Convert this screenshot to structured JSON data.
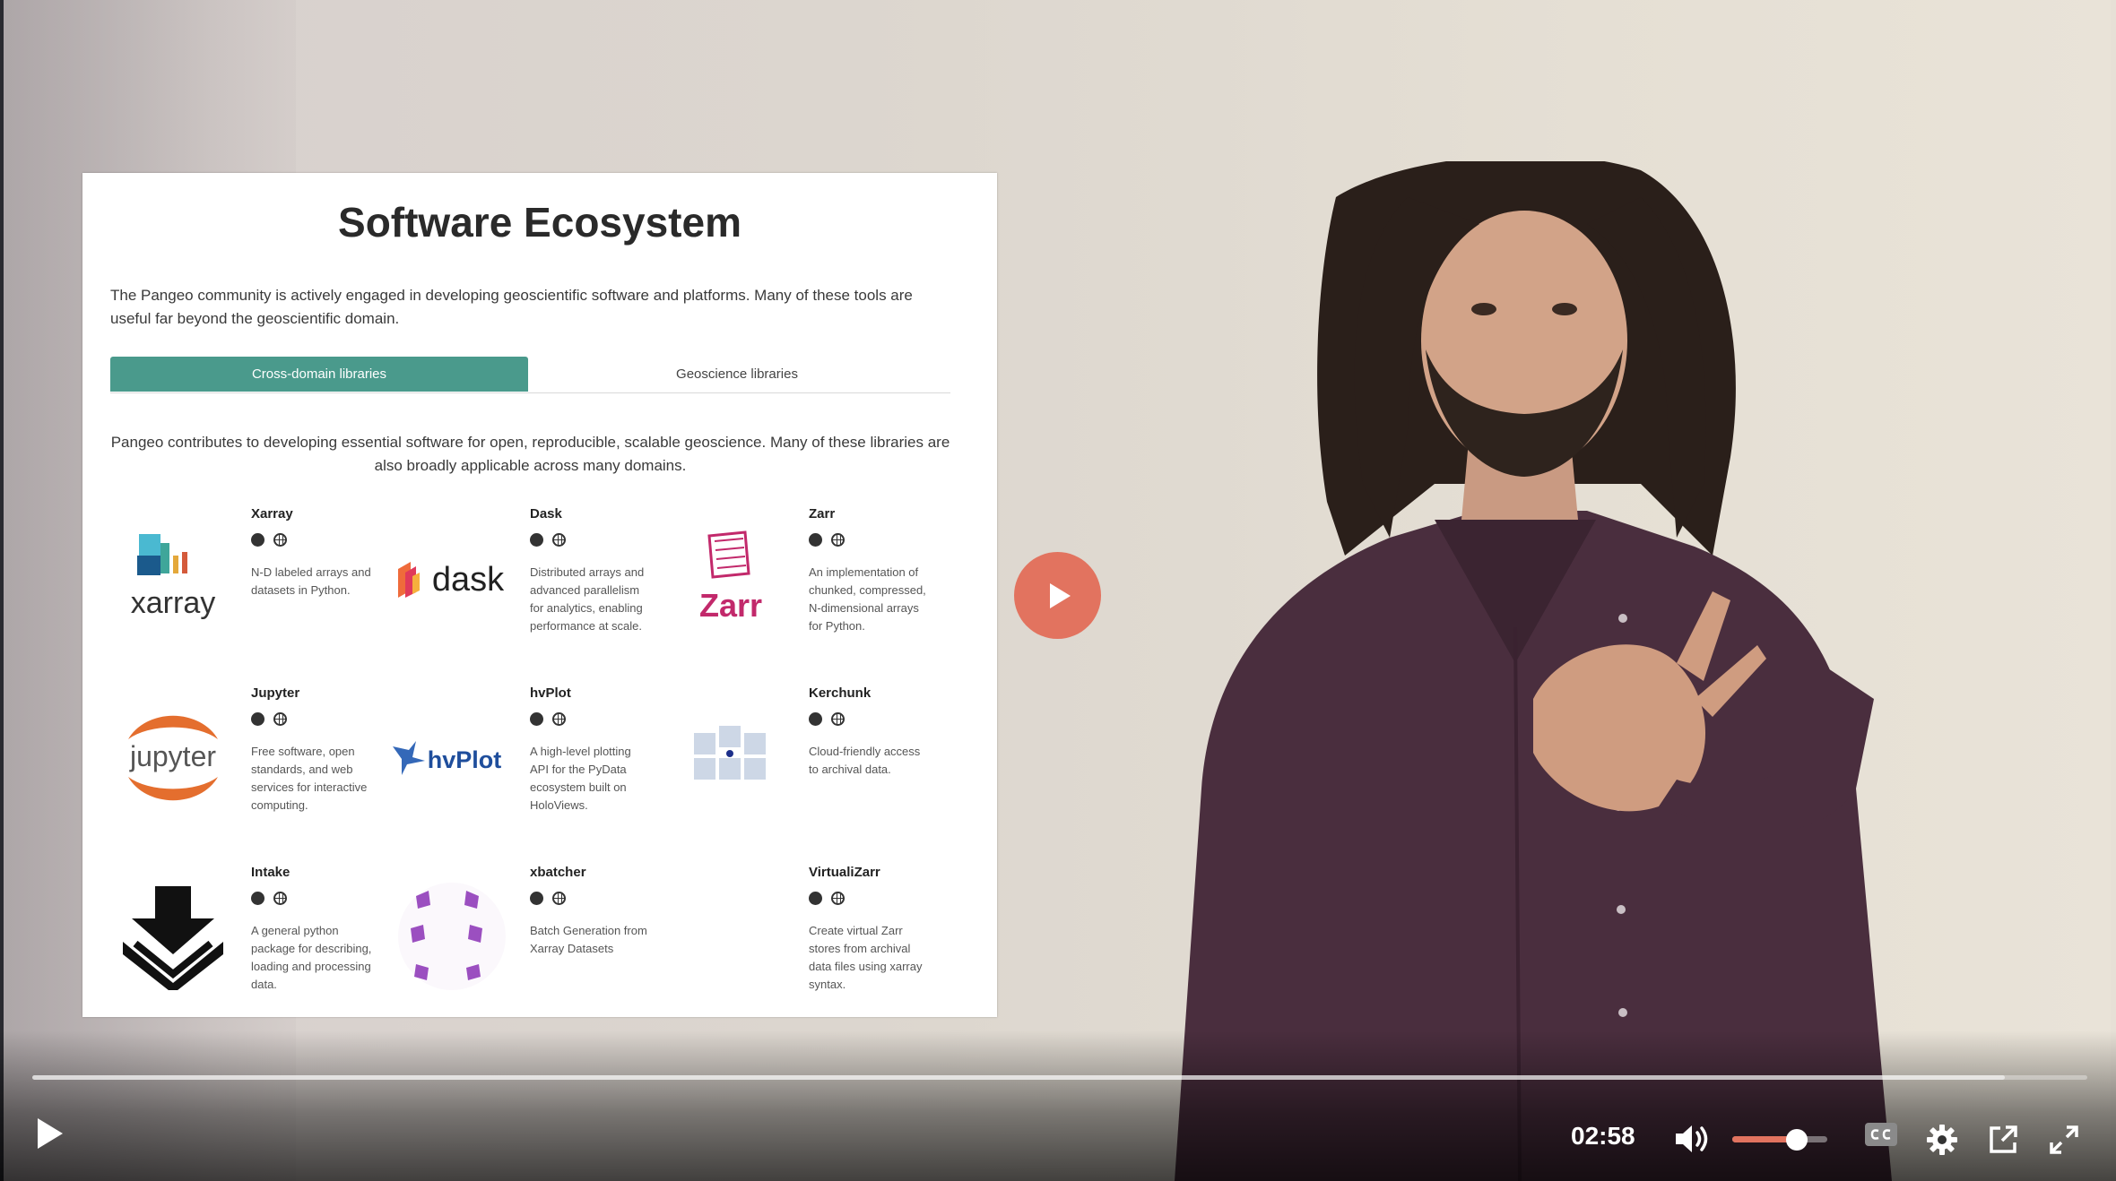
{
  "slide": {
    "title": "Software Ecosystem",
    "intro": "The Pangeo community is actively engaged in developing geoscientific software and platforms. Many of these tools are useful far beyond the geoscientific domain.",
    "tabs": [
      {
        "label": "Cross-domain libraries",
        "active": true
      },
      {
        "label": "Geoscience libraries",
        "active": false
      }
    ],
    "subintro": "Pangeo contributes to developing essential software for open, reproducible, scalable geoscience. Many of these libraries are also broadly applicable across many domains.",
    "libraries": [
      {
        "name": "Xarray",
        "logo_text": "xarray",
        "description": "N-D labeled arrays and datasets in Python."
      },
      {
        "name": "Dask",
        "logo_text": "dask",
        "description": "Distributed arrays and advanced parallelism for analytics, enabling performance at scale."
      },
      {
        "name": "Zarr",
        "logo_text": "Zarr",
        "description": "An implementation of chunked, compressed, N-dimensional arrays for Python."
      },
      {
        "name": "Jupyter",
        "logo_text": "jupyter",
        "description": "Free software, open standards, and web services for interactive computing."
      },
      {
        "name": "hvPlot",
        "logo_text": "hvPlot",
        "description": "A high-level plotting API for the PyData ecosystem built on HoloViews."
      },
      {
        "name": "Kerchunk",
        "logo_text": "",
        "description": "Cloud-friendly access to archival data."
      },
      {
        "name": "Intake",
        "logo_text": "",
        "description": "A general python package for describing, loading and processing data."
      },
      {
        "name": "xbatcher",
        "logo_text": "",
        "description": "Batch Generation from Xarray Datasets"
      },
      {
        "name": "VirtualiZarr",
        "logo_text": "",
        "description": "Create virtual Zarr stores from archival data files using xarray syntax."
      }
    ],
    "link_icons": [
      "github-icon",
      "globe-icon"
    ]
  },
  "player": {
    "time": "02:58",
    "buffered": 0.96,
    "progress": 0.0,
    "volume": 0.68,
    "accent_color": "#e2735f",
    "icons": [
      "play-icon",
      "volume-icon",
      "closed-captions-icon",
      "settings-icon",
      "popout-icon",
      "fullscreen-icon"
    ]
  }
}
